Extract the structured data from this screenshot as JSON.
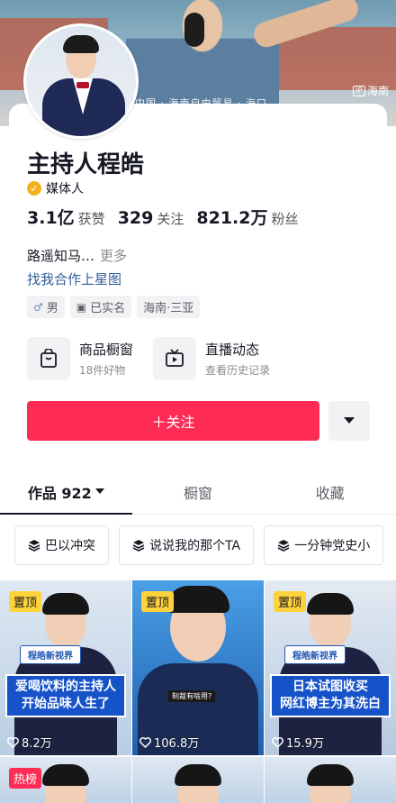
{
  "banner": {
    "caption": "中国 · 海南自由贸易 · 海口",
    "watermark_box": "IP",
    "watermark_text": "海南"
  },
  "profile": {
    "name": "主持人程皓",
    "verify_label": "媒体人",
    "stats": [
      {
        "num": "3.1亿",
        "label": "获赞"
      },
      {
        "num": "329",
        "label": "关注"
      },
      {
        "num": "821.2万",
        "label": "粉丝"
      }
    ],
    "bio": "路遥知马…",
    "bio_more": "更多",
    "cooperate": "找我合作上星图",
    "tags": [
      {
        "icon": "♂",
        "label": "男"
      },
      {
        "icon": "▣",
        "label": "已实名"
      },
      {
        "icon": "",
        "label": "海南·三亚"
      }
    ],
    "features": [
      {
        "title": "商品橱窗",
        "sub": "18件好物",
        "icon": "shopping-bag-icon"
      },
      {
        "title": "直播动态",
        "sub": "查看历史记录",
        "icon": "tv-icon"
      }
    ],
    "follow_label": "＋关注"
  },
  "tabs": [
    {
      "label": "作品 922",
      "active": true
    },
    {
      "label": "橱窗",
      "active": false
    },
    {
      "label": "收藏",
      "active": false
    }
  ],
  "collections": [
    "巴以冲突",
    "说说我的那个TA",
    "一分钟党史小"
  ],
  "videos": [
    {
      "pin": "置顶",
      "brand": "程皓新视界",
      "caption": "爱喝饮料的主持人\n开始品味人生了",
      "likes": "8.2万"
    },
    {
      "pin": "置顶",
      "brand": "",
      "caption": "",
      "subtitle": "制裁有啥用?",
      "likes": "106.8万"
    },
    {
      "pin": "置顶",
      "brand": "程皓新视界",
      "caption": "日本试图收买\n网红博主为其洗白",
      "likes": "15.9万"
    }
  ],
  "videos_row2": [
    {
      "pin": "热榜"
    },
    {
      "pin": ""
    },
    {
      "pin": ""
    }
  ],
  "colors": {
    "accent": "#fe2c55",
    "link": "#2f5e99",
    "badge": "#f2b21d"
  }
}
